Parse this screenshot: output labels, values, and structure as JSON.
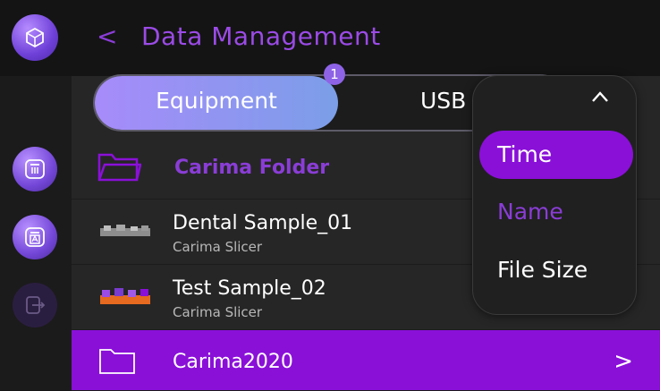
{
  "header": {
    "title": "Data Management",
    "back_icon": "chevron-left-icon"
  },
  "tabs": {
    "equipment_label": "Equipment",
    "usb_label": "USB",
    "badge_count": "1"
  },
  "files": [
    {
      "name": "Carima Folder",
      "type": "folder",
      "icon": "folder-icon"
    },
    {
      "name": "Dental Sample_01",
      "sub": "Carima Slicer",
      "type": "file"
    },
    {
      "name": "Test Sample_02",
      "sub": "Carima Slicer",
      "type": "file"
    },
    {
      "name": "Carima2020",
      "type": "folder",
      "icon": "folder-icon"
    }
  ],
  "sort_menu": {
    "options": [
      "Time",
      "Name",
      "File Size"
    ],
    "selected": "Time"
  },
  "colors": {
    "accent": "#8a10d8",
    "accent_text": "#8a3dd6",
    "background": "#161616"
  }
}
